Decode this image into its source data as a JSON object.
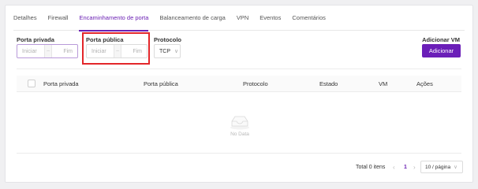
{
  "tabs": [
    {
      "label": "Detalhes"
    },
    {
      "label": "Firewall"
    },
    {
      "label": "Encaminhamento de porta",
      "active": true
    },
    {
      "label": "Balanceamento de carga"
    },
    {
      "label": "VPN"
    },
    {
      "label": "Eventos"
    },
    {
      "label": "Comentários"
    }
  ],
  "filters": {
    "private_port": {
      "label": "Porta privada",
      "start_placeholder": "Iniciar",
      "end_placeholder": "Fim",
      "separator": "~"
    },
    "public_port": {
      "label": "Porta pública",
      "start_placeholder": "Iniciar",
      "end_placeholder": "Fim",
      "separator": "~"
    },
    "protocol": {
      "label": "Protocolo",
      "value": "TCP"
    }
  },
  "add": {
    "label": "Adicionar VM",
    "button": "Adicionar"
  },
  "table": {
    "columns": [
      "Porta privada",
      "Porta pública",
      "Protocolo",
      "Estado",
      "VM",
      "Ações"
    ],
    "empty_text": "No Data"
  },
  "pagination": {
    "total": "Total 0 itens",
    "current_page": "1",
    "page_size": "10 / página"
  },
  "colors": {
    "accent": "#6b1fb8",
    "highlight": "#e3262a"
  }
}
